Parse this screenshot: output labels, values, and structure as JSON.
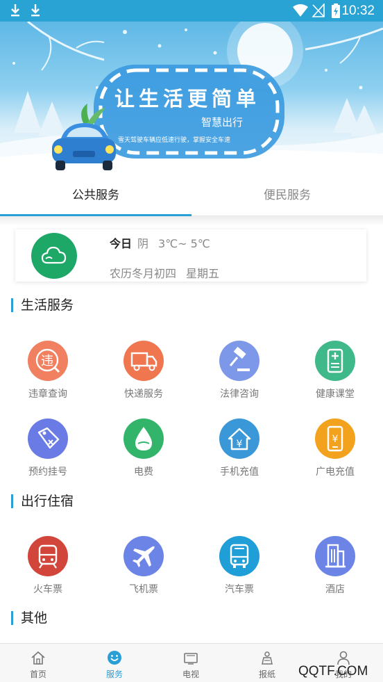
{
  "status_bar": {
    "time": "10:32"
  },
  "banner": {
    "headline": "让生活更简单",
    "subtitle": "智慧出行",
    "slogan": "雪天驾驶车辆应低速行驶，掌握安全车速"
  },
  "tabs": [
    {
      "label": "公共服务",
      "active": true
    },
    {
      "label": "便民服务",
      "active": false
    }
  ],
  "weather": {
    "day": "今日",
    "condition": "阴",
    "temperature": "3℃~ 5℃",
    "lunar_date": "农历冬月初四",
    "weekday": "星期五",
    "icon": "cloud-icon"
  },
  "sections": {
    "life": {
      "title": "生活服务",
      "items": [
        {
          "label": "违章查询",
          "icon": "violation-icon",
          "color": "#f0805f"
        },
        {
          "label": "快递服务",
          "icon": "truck-icon",
          "color": "#f07650"
        },
        {
          "label": "法律咨询",
          "icon": "gavel-icon",
          "color": "#7d98e8"
        },
        {
          "label": "健康课堂",
          "icon": "health-icon",
          "color": "#3fb88a"
        },
        {
          "label": "预约挂号",
          "icon": "ticket-tag-icon",
          "color": "#6a7be6"
        },
        {
          "label": "电费",
          "icon": "water-drop-icon",
          "color": "#32b56b"
        },
        {
          "label": "手机充值",
          "icon": "house-yuan-icon",
          "color": "#3b98d8"
        },
        {
          "label": "广电充值",
          "icon": "phone-yuan-icon",
          "color": "#f3a21e"
        }
      ]
    },
    "travel": {
      "title": "出行住宿",
      "items": [
        {
          "label": "火车票",
          "icon": "train-icon",
          "color": "#d2453a"
        },
        {
          "label": "飞机票",
          "icon": "airplane-icon",
          "color": "#6c84e6"
        },
        {
          "label": "汽车票",
          "icon": "bus-icon",
          "color": "#1f9ed8"
        },
        {
          "label": "酒店",
          "icon": "hotel-icon",
          "color": "#6c84e6"
        }
      ]
    },
    "other": {
      "title": "其他"
    }
  },
  "bottom_nav": [
    {
      "label": "首页",
      "icon": "home-icon",
      "active": false
    },
    {
      "label": "服务",
      "icon": "smile-icon",
      "active": true
    },
    {
      "label": "电视",
      "icon": "tv-icon",
      "active": false
    },
    {
      "label": "报纸",
      "icon": "newspaper-icon",
      "active": false
    },
    {
      "label": "我的",
      "icon": "user-icon",
      "active": false
    }
  ],
  "watermark": "QQTF.COM",
  "colors": {
    "accent": "#2a9fd6",
    "status_bar": "#29a3d4"
  }
}
